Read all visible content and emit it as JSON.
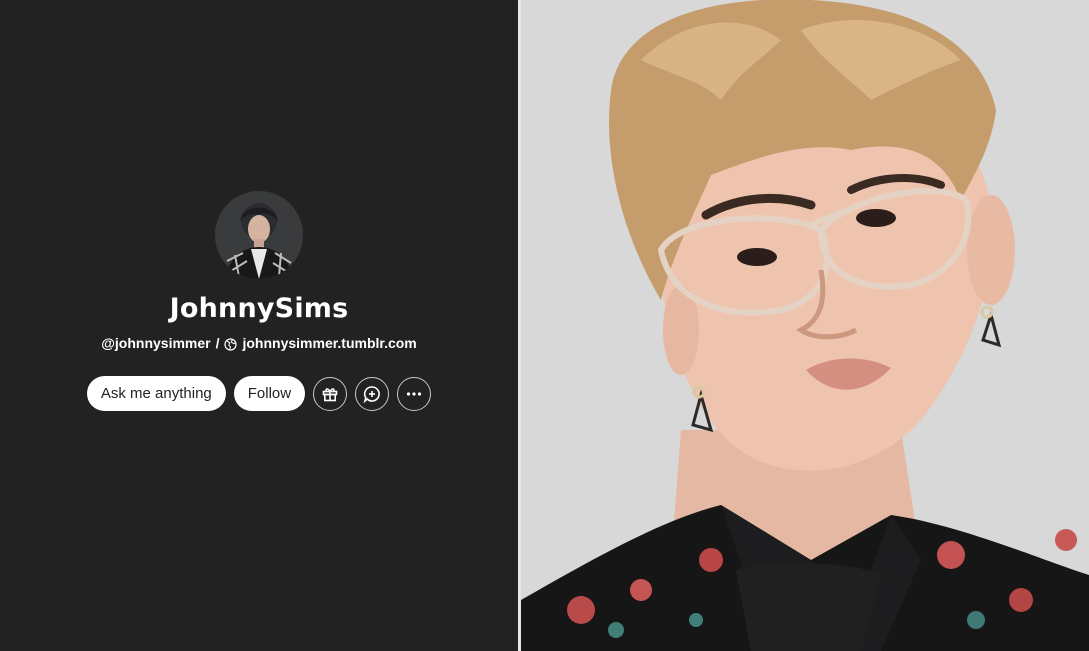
{
  "blog": {
    "title": "JohnnySims",
    "handle": "@johnnysimmer",
    "separator": "/",
    "url": "johnnysimmer.tumblr.com"
  },
  "actions": {
    "ask_label": "Ask me anything",
    "follow_label": "Follow",
    "gift_icon": "gift-icon",
    "chat_icon": "chat-plus-icon",
    "more_icon": "more-dots-icon"
  },
  "colors": {
    "panel_bg": "#222222",
    "button_bg": "#ffffff",
    "button_text": "#222222",
    "text": "#ffffff"
  }
}
